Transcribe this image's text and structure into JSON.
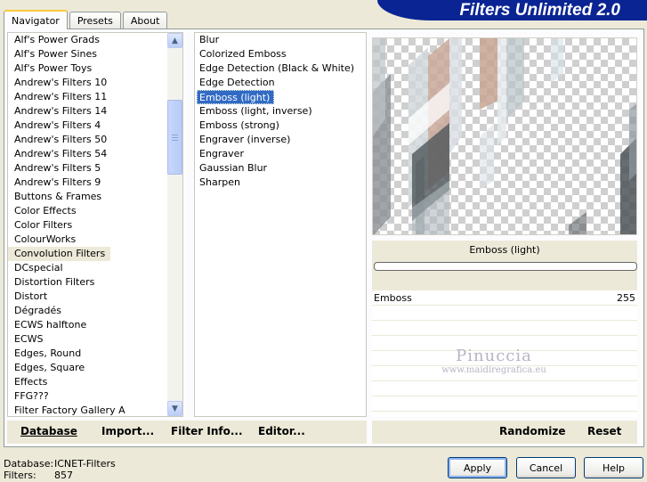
{
  "tabs": [
    "Navigator",
    "Presets",
    "About"
  ],
  "banner": "Filters Unlimited 2.0",
  "categories": {
    "items": [
      "Alf's Power Grads",
      "Alf's Power Sines",
      "Alf's Power Toys",
      "Andrew's Filters 10",
      "Andrew's Filters 11",
      "Andrew's Filters 14",
      "Andrew's Filters 4",
      "Andrew's Filters 50",
      "Andrew's Filters 54",
      "Andrew's Filters 5",
      "Andrew's Filters 9",
      "Buttons & Frames",
      "Color Effects",
      "Color Filters",
      "ColourWorks",
      "Convolution Filters",
      "DCspecial",
      "Distortion Filters",
      "Distort",
      "Dégradés",
      "ECWS halftone",
      "ECWS",
      "Edges, Round",
      "Edges, Square",
      "Effects",
      "FFG???",
      "Filter Factory Gallery A"
    ],
    "selected_index": 15,
    "up_arrow": "▲",
    "down_arrow": "▼"
  },
  "filters": {
    "items": [
      "Blur",
      "Colorized Emboss",
      "Edge Detection (Black & White)",
      "Edge Detection",
      "Emboss (light)",
      "Emboss (light, inverse)",
      "Emboss (strong)",
      "Engraver (inverse)",
      "Engraver",
      "Gaussian Blur",
      "Sharpen"
    ],
    "selected_index": 4
  },
  "preview": {
    "filter_name": "Emboss (light)"
  },
  "params": [
    {
      "label": "Emboss",
      "value": "255"
    }
  ],
  "watermark": {
    "line1": "Pinuccia",
    "line2": "www.maidiregrafica.eu"
  },
  "left_buttons": {
    "database": "Database",
    "import": "Import...",
    "filter_info": "Filter Info...",
    "editor": "Editor..."
  },
  "right_buttons": {
    "randomize": "Randomize",
    "reset": "Reset"
  },
  "info": {
    "database_label": "Database:",
    "database_value": "ICNET-Filters",
    "filters_label": "Filters:",
    "filters_value": "857"
  },
  "dialog_buttons": {
    "apply": "Apply",
    "cancel": "Cancel",
    "help": "Help"
  }
}
